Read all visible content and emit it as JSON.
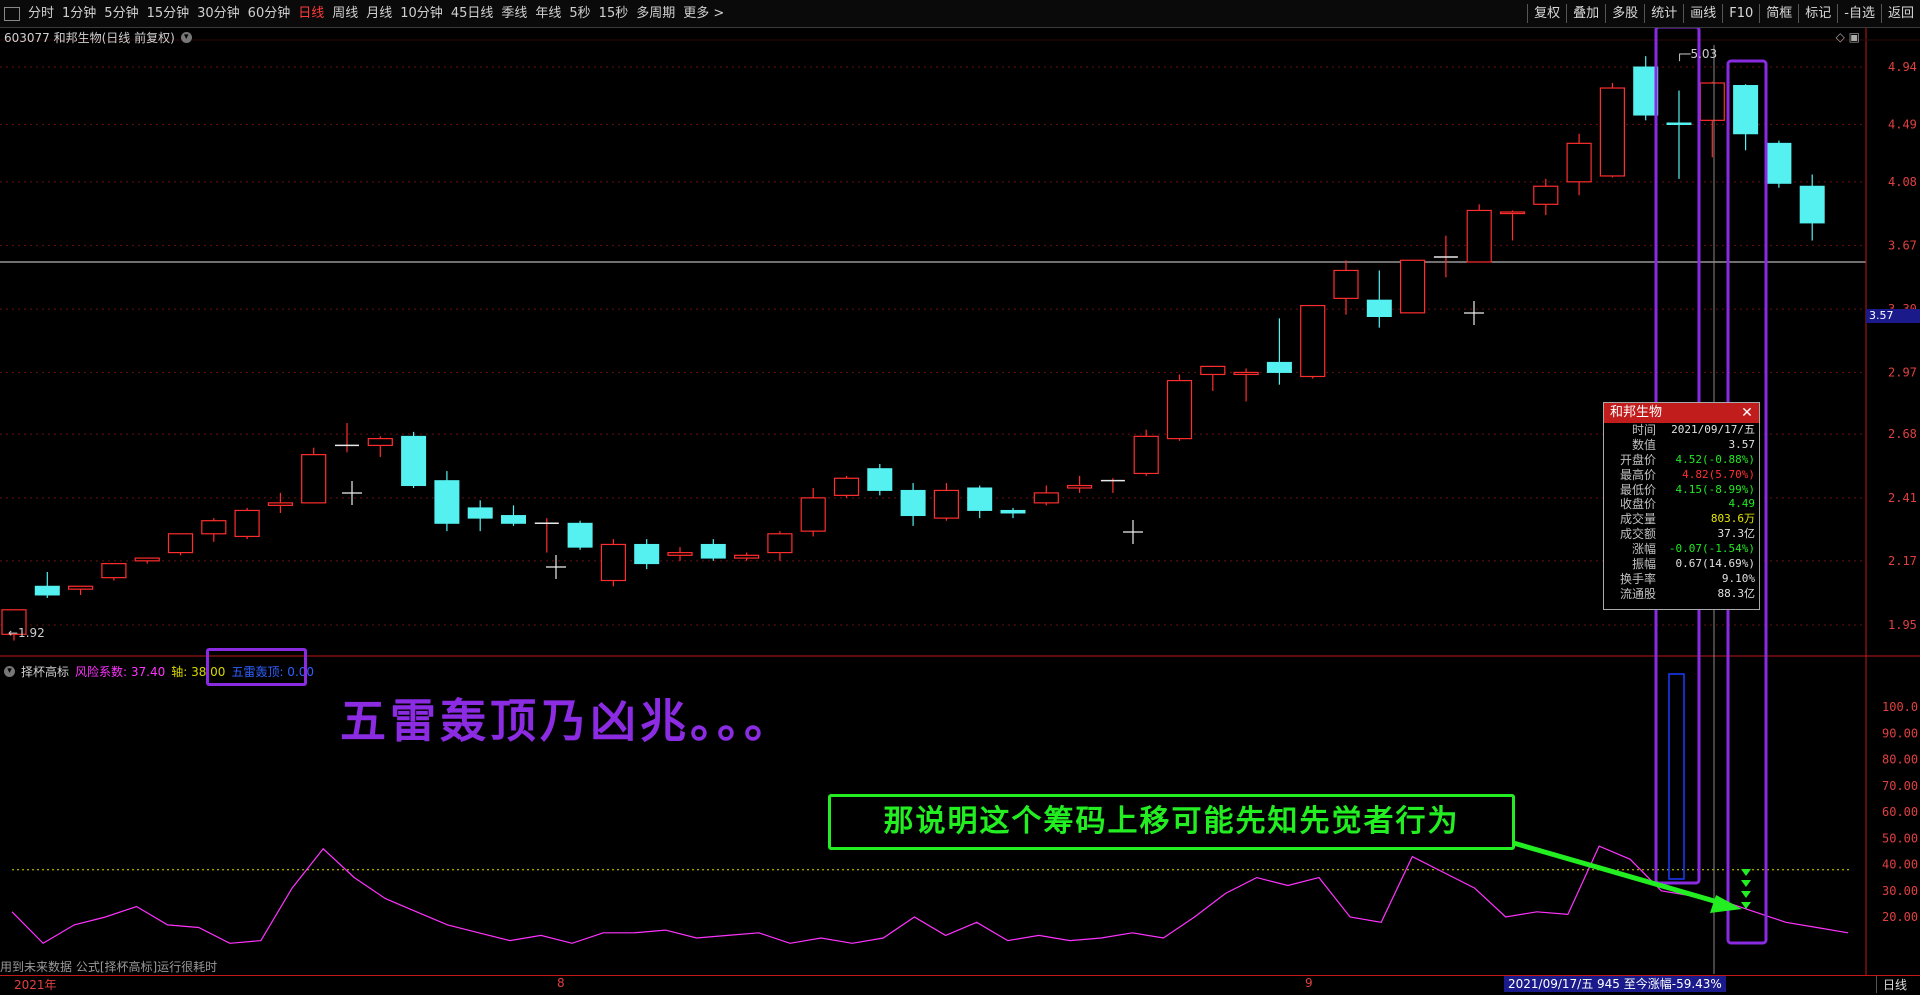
{
  "toolbar": {
    "left_items": [
      "分时",
      "1分钟",
      "5分钟",
      "15分钟",
      "30分钟",
      "60分钟",
      "日线",
      "周线",
      "月线",
      "10分钟",
      "45日线",
      "季线",
      "年线",
      "5秒",
      "15秒",
      "多周期",
      "更多 >"
    ],
    "active_item": "日线",
    "right_items": [
      "复权",
      "叠加",
      "多股",
      "统计",
      "画线",
      "F10",
      "简框",
      "标记",
      "-自选",
      "返回"
    ]
  },
  "stock": {
    "title": "603077 和邦生物(日线 前复权)"
  },
  "price_axis": {
    "ticks": [
      "4.94",
      "4.49",
      "4.08",
      "3.67",
      "3.30",
      "2.97",
      "2.68",
      "2.41",
      "2.17",
      "1.95"
    ],
    "current_price": "3.57",
    "low_label": "←1.92",
    "high_label": "5.03"
  },
  "chart_data": {
    "type": "candlestick",
    "title": "603077 和邦生物(日线 前复权)",
    "colors": {
      "up": "#ff2d2d",
      "down": "#55f0f0",
      "indicator_line": "#ff33ff",
      "grid": "#6a1010"
    },
    "ohlc": [
      {
        "o": 1.92,
        "h": 2.0,
        "l": 1.9,
        "c": 2.0
      },
      {
        "o": 2.08,
        "h": 2.13,
        "l": 2.04,
        "c": 2.05
      },
      {
        "o": 2.07,
        "h": 2.08,
        "l": 2.05,
        "c": 2.08
      },
      {
        "o": 2.11,
        "h": 2.16,
        "l": 2.1,
        "c": 2.16
      },
      {
        "o": 2.17,
        "h": 2.18,
        "l": 2.16,
        "c": 2.18
      },
      {
        "o": 2.2,
        "h": 2.27,
        "l": 2.19,
        "c": 2.27
      },
      {
        "o": 2.27,
        "h": 2.33,
        "l": 2.24,
        "c": 2.32
      },
      {
        "o": 2.26,
        "h": 2.37,
        "l": 2.25,
        "c": 2.36
      },
      {
        "o": 2.38,
        "h": 2.43,
        "l": 2.35,
        "c": 2.39
      },
      {
        "o": 2.39,
        "h": 2.62,
        "l": 2.39,
        "c": 2.59
      },
      {
        "o": 2.63,
        "h": 2.73,
        "l": 2.6,
        "c": 2.63
      },
      {
        "o": 2.63,
        "h": 2.67,
        "l": 2.58,
        "c": 2.66
      },
      {
        "o": 2.67,
        "h": 2.69,
        "l": 2.45,
        "c": 2.46
      },
      {
        "o": 2.48,
        "h": 2.52,
        "l": 2.28,
        "c": 2.31
      },
      {
        "o": 2.37,
        "h": 2.4,
        "l": 2.28,
        "c": 2.33
      },
      {
        "o": 2.34,
        "h": 2.38,
        "l": 2.3,
        "c": 2.31
      },
      {
        "o": 2.31,
        "h": 2.33,
        "l": 2.2,
        "c": 2.31
      },
      {
        "o": 2.31,
        "h": 2.32,
        "l": 2.21,
        "c": 2.22
      },
      {
        "o": 2.1,
        "h": 2.25,
        "l": 2.08,
        "c": 2.23
      },
      {
        "o": 2.23,
        "h": 2.25,
        "l": 2.14,
        "c": 2.16
      },
      {
        "o": 2.19,
        "h": 2.22,
        "l": 2.17,
        "c": 2.2
      },
      {
        "o": 2.23,
        "h": 2.25,
        "l": 2.17,
        "c": 2.18
      },
      {
        "o": 2.18,
        "h": 2.2,
        "l": 2.17,
        "c": 2.19
      },
      {
        "o": 2.2,
        "h": 2.28,
        "l": 2.17,
        "c": 2.27
      },
      {
        "o": 2.28,
        "h": 2.45,
        "l": 2.26,
        "c": 2.41
      },
      {
        "o": 2.42,
        "h": 2.5,
        "l": 2.41,
        "c": 2.49
      },
      {
        "o": 2.53,
        "h": 2.55,
        "l": 2.42,
        "c": 2.44
      },
      {
        "o": 2.44,
        "h": 2.47,
        "l": 2.3,
        "c": 2.34
      },
      {
        "o": 2.33,
        "h": 2.47,
        "l": 2.32,
        "c": 2.44
      },
      {
        "o": 2.45,
        "h": 2.46,
        "l": 2.33,
        "c": 2.36
      },
      {
        "o": 2.36,
        "h": 2.37,
        "l": 2.33,
        "c": 2.35
      },
      {
        "o": 2.39,
        "h": 2.46,
        "l": 2.38,
        "c": 2.43
      },
      {
        "o": 2.45,
        "h": 2.5,
        "l": 2.43,
        "c": 2.46
      },
      {
        "o": 2.48,
        "h": 2.49,
        "l": 2.43,
        "c": 2.48
      },
      {
        "o": 2.51,
        "h": 2.7,
        "l": 2.5,
        "c": 2.67
      },
      {
        "o": 2.66,
        "h": 2.96,
        "l": 2.65,
        "c": 2.93
      },
      {
        "o": 2.96,
        "h": 3.0,
        "l": 2.88,
        "c": 3.0
      },
      {
        "o": 2.96,
        "h": 2.99,
        "l": 2.83,
        "c": 2.97
      },
      {
        "o": 3.02,
        "h": 3.25,
        "l": 2.91,
        "c": 2.97
      },
      {
        "o": 2.95,
        "h": 3.32,
        "l": 2.94,
        "c": 3.32
      },
      {
        "o": 3.36,
        "h": 3.58,
        "l": 3.27,
        "c": 3.52
      },
      {
        "o": 3.35,
        "h": 3.52,
        "l": 3.2,
        "c": 3.26
      },
      {
        "o": 3.28,
        "h": 3.58,
        "l": 3.28,
        "c": 3.58
      },
      {
        "o": 3.6,
        "h": 3.73,
        "l": 3.48,
        "c": 3.6
      },
      {
        "o": 3.57,
        "h": 3.93,
        "l": 3.57,
        "c": 3.89
      },
      {
        "o": 3.87,
        "h": 3.89,
        "l": 3.7,
        "c": 3.88
      },
      {
        "o": 3.93,
        "h": 4.1,
        "l": 3.86,
        "c": 4.05
      },
      {
        "o": 4.08,
        "h": 4.42,
        "l": 3.99,
        "c": 4.35
      },
      {
        "o": 4.12,
        "h": 4.81,
        "l": 4.11,
        "c": 4.77
      },
      {
        "o": 4.94,
        "h": 5.03,
        "l": 4.52,
        "c": 4.56
      },
      {
        "o": 4.5,
        "h": 4.75,
        "l": 4.1,
        "c": 4.49
      },
      {
        "o": 4.52,
        "h": 4.82,
        "l": 4.25,
        "c": 4.81
      },
      {
        "o": 4.79,
        "h": 4.8,
        "l": 4.3,
        "c": 4.42
      },
      {
        "o": 4.35,
        "h": 4.37,
        "l": 4.04,
        "c": 4.07
      },
      {
        "o": 4.05,
        "h": 4.13,
        "l": 3.7,
        "c": 3.81
      }
    ],
    "indicator": {
      "name": "择杯高标",
      "axis_ticks": [
        "100.0",
        "90.00",
        "80.00",
        "70.00",
        "60.00",
        "50.00",
        "40.00",
        "30.00",
        "20.00"
      ],
      "risk_values": [
        22,
        10,
        17,
        20,
        24,
        17,
        16,
        10,
        11,
        31,
        46,
        35,
        27,
        22,
        17,
        14,
        11,
        13,
        10,
        14,
        14,
        15,
        12,
        13,
        14,
        10,
        12,
        10,
        12,
        20,
        13,
        18,
        11,
        13,
        11,
        12,
        14,
        12,
        20,
        29,
        35,
        32,
        35,
        20,
        18,
        43,
        37,
        31,
        20,
        22,
        21,
        47,
        42,
        30,
        28,
        26,
        22,
        18,
        16,
        14
      ]
    },
    "xaxis_labels": [
      "2021年",
      "8",
      "9"
    ]
  },
  "indicator_header": {
    "name": "择杯高标",
    "risk": "风险系数: 37.40",
    "axis": "轴: 38.00",
    "wulei": "五雷轰顶: 0.00"
  },
  "annotations": {
    "big_text": "五雷轰顶乃凶兆。。。",
    "green_text": "那说明这个筹码上移可能先知先觉者行为"
  },
  "info_box": {
    "title": "和邦生物",
    "rows": [
      {
        "k": "时间",
        "v": "2021/09/17/五",
        "color": "#e0e0e0"
      },
      {
        "k": "数值",
        "v": "3.57",
        "color": "#e0e0e0"
      },
      {
        "k": "开盘价",
        "v": "4.52(-0.88%)",
        "color": "#22e822"
      },
      {
        "k": "最高价",
        "v": "4.82(5.70%)",
        "color": "#ff3030"
      },
      {
        "k": "最低价",
        "v": "4.15(-8.99%)",
        "color": "#22e822"
      },
      {
        "k": "收盘价",
        "v": "4.49",
        "color": "#22e822"
      },
      {
        "k": "成交量",
        "v": "803.6万",
        "color": "#e8e800"
      },
      {
        "k": "成交额",
        "v": "37.3亿",
        "color": "#e0e0e0"
      },
      {
        "k": "涨幅",
        "v": "-0.07(-1.54%)",
        "color": "#22e822"
      },
      {
        "k": "振幅",
        "v": "0.67(14.69%)",
        "color": "#e0e0e0"
      },
      {
        "k": "换手率",
        "v": "9.10%",
        "color": "#e0e0e0"
      },
      {
        "k": "流通股",
        "v": "88.3亿",
        "color": "#e0e0e0"
      }
    ]
  },
  "bottom": {
    "note": "用到未来数据 公式[择杯高标]运行很耗时",
    "date_start": "2021年",
    "date_mid1": "8",
    "date_mid2": "9",
    "range_info": "2021/09/17/五 945 至今涨幅-59.43%",
    "tab_day": "日线"
  }
}
